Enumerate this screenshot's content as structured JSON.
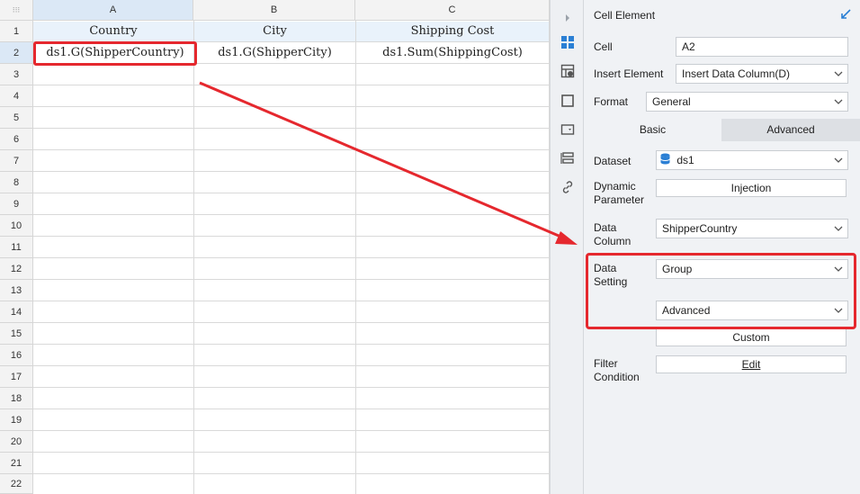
{
  "sheet": {
    "corner_glyph": "⁝⁝⁝",
    "columns": [
      "A",
      "B",
      "C"
    ],
    "rows": [
      "1",
      "2",
      "3",
      "4",
      "5",
      "6",
      "7",
      "8",
      "9",
      "10",
      "11",
      "12",
      "13",
      "14",
      "15",
      "16",
      "17",
      "18",
      "19",
      "20",
      "21",
      "22"
    ],
    "header_row": [
      "Country",
      "City",
      "Shipping Cost"
    ],
    "data_row": [
      "ds1.G(ShipperCountry)",
      "ds1.G(ShipperCity)",
      "ds1.Sum(ShippingCost)"
    ]
  },
  "toolbar": {
    "icons": [
      "expand-icon",
      "cell-element-icon",
      "cell-attribute-icon",
      "border-icon",
      "widget-icon",
      "report-block-icon",
      "hyperlink-icon"
    ]
  },
  "panel": {
    "title": "Cell Element",
    "cell_label": "Cell",
    "cell_value": "A2",
    "insert_label": "Insert Element",
    "insert_value": "Insert Data Column(D)",
    "format_label": "Format",
    "format_value": "General",
    "tabs": [
      "Basic",
      "Advanced"
    ],
    "dataset_label": "Dataset",
    "dataset_value": "ds1",
    "dynamic_label_1": "Dynamic",
    "dynamic_label_2": "Parameter",
    "dynamic_button": "Injection",
    "data_column_label_1": "Data",
    "data_column_label_2": "Column",
    "data_column_value": "ShipperCountry",
    "data_setting_label_1": "Data",
    "data_setting_label_2": "Setting",
    "data_setting_value": "Group",
    "advanced_value": "Advanced",
    "custom_button": "Custom",
    "filter_label_1": "Filter",
    "filter_label_2": "Condition",
    "edit_button": "Edit"
  },
  "colors": {
    "highlight_red": "#e5282e",
    "accent_blue": "#2a7fd4",
    "selected_header": "#dbe8f6"
  }
}
